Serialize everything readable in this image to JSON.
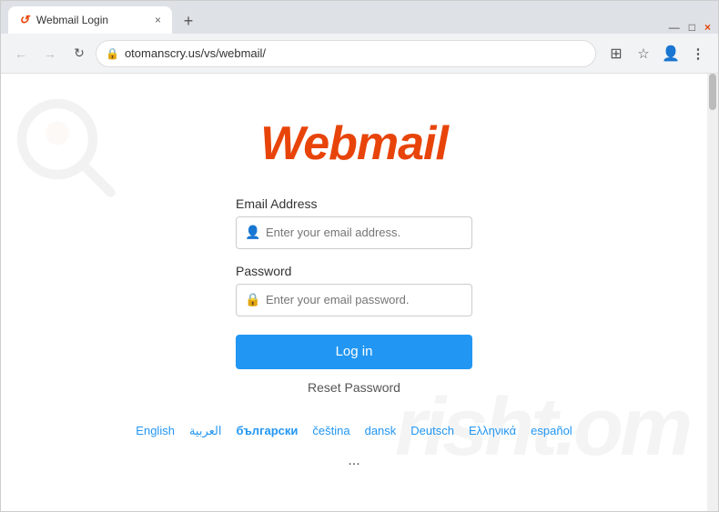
{
  "browser": {
    "tab": {
      "favicon": "↺",
      "title": "Webmail Login",
      "close_icon": "×"
    },
    "new_tab_icon": "+",
    "window_controls": {
      "minimize": "—",
      "maximize": "□",
      "close": "×"
    },
    "toolbar": {
      "back_icon": "←",
      "forward_icon": "→",
      "reload_icon": "↻",
      "url": "otomanscry.us/vs/webmail/",
      "lock_icon": "🔒",
      "grid_icon": "⊞",
      "star_icon": "☆",
      "profile_icon": "👤",
      "menu_icon": "⋮"
    }
  },
  "page": {
    "logo": "Webmail",
    "watermark": "risht.om",
    "email_label": "Email Address",
    "email_placeholder": "Enter your email address.",
    "password_label": "Password",
    "password_placeholder": "Enter your email password.",
    "login_button": "Log in",
    "reset_link": "Reset Password",
    "languages": [
      {
        "label": "English",
        "active": true,
        "bold": false
      },
      {
        "label": "العربية",
        "active": false,
        "bold": false
      },
      {
        "label": "български",
        "active": false,
        "bold": true
      },
      {
        "label": "čeština",
        "active": false,
        "bold": false
      },
      {
        "label": "dansk",
        "active": false,
        "bold": false
      },
      {
        "label": "Deutsch",
        "active": false,
        "bold": false
      },
      {
        "label": "Ελληνικά",
        "active": false,
        "bold": false
      },
      {
        "label": "español",
        "active": false,
        "bold": false
      }
    ],
    "more_languages_icon": "..."
  }
}
